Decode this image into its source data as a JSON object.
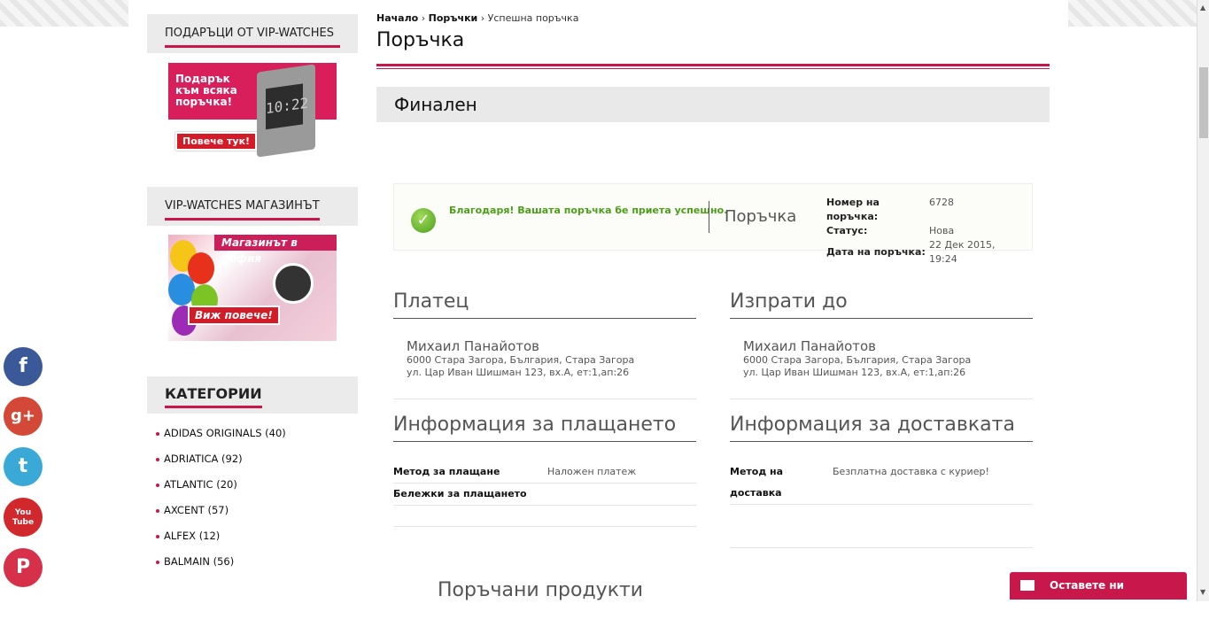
{
  "breadcrumb": {
    "home": "Начало",
    "orders": "Поръчки",
    "current": "Успешна поръчка",
    "sep": "›"
  },
  "page_title": "Поръчка",
  "step_title": "Финален",
  "sidebar": {
    "gifts_title": "ПОДАРЪЦИ ОТ VIP-WATCHES",
    "gift_banner_text": "Подарък към всяка поръчка!",
    "gift_banner_button": "Повече тук!",
    "clock_time": "10:22",
    "store_title": "VIP-WATCHES МАГАЗИНЪТ",
    "store_banner_title": "Магазинът в София",
    "store_banner_button": "Виж повече!",
    "categories_title": "КАТЕГОРИИ",
    "categories": [
      "ADIDAS ORIGINALS (40)",
      "ADRIATICA (92)",
      "ATLANTIC (20)",
      "AXCENT (57)",
      "ALFEX (12)",
      "BALMAIN (56)"
    ]
  },
  "success": {
    "message": "Благодаря! Вашата поръчка бе приета успешно.",
    "order_label": "Поръчка",
    "order_number_label": "Номер на поръчка:",
    "order_number": "6728",
    "status_label": "Статус:",
    "status": "Нова",
    "date_label": "Дата на поръчка:",
    "date": "22 Дек 2015, 19:24"
  },
  "payer": {
    "title": "Платец",
    "name": "Михаил Панайотов",
    "line1": "6000 Стара Загора, България, Стара Загора",
    "line2": "ул. Цар Иван Шишман 123, вх.А, ет:1,ап:26"
  },
  "ship_to": {
    "title": "Изпрати до",
    "name": "Михаил Панайотов",
    "line1": "6000 Стара Загора, България, Стара Загора",
    "line2": "ул. Цар Иван Шишман 123, вх.А, ет:1,ап:26"
  },
  "payment_info": {
    "title": "Информация за плащането",
    "method_label": "Метод за плащане",
    "method": "Наложен платеж",
    "notes_label": "Бележки за плащането"
  },
  "delivery_info": {
    "title": "Информация за доставката",
    "method_label": "Метод на доставка",
    "method": "Безплатна доставка с куриер!"
  },
  "products_title": "Поръчани продукти",
  "social": [
    "facebook",
    "google-plus",
    "twitter",
    "youtube",
    "pinterest"
  ],
  "social_glyphs": {
    "facebook": "f",
    "google-plus": "g+",
    "twitter": "t",
    "youtube": "You Tube",
    "pinterest": "P"
  },
  "message_button": "Оставете ни съобщение!",
  "colors": {
    "accent": "#c8174a",
    "success": "#4b9f17"
  }
}
